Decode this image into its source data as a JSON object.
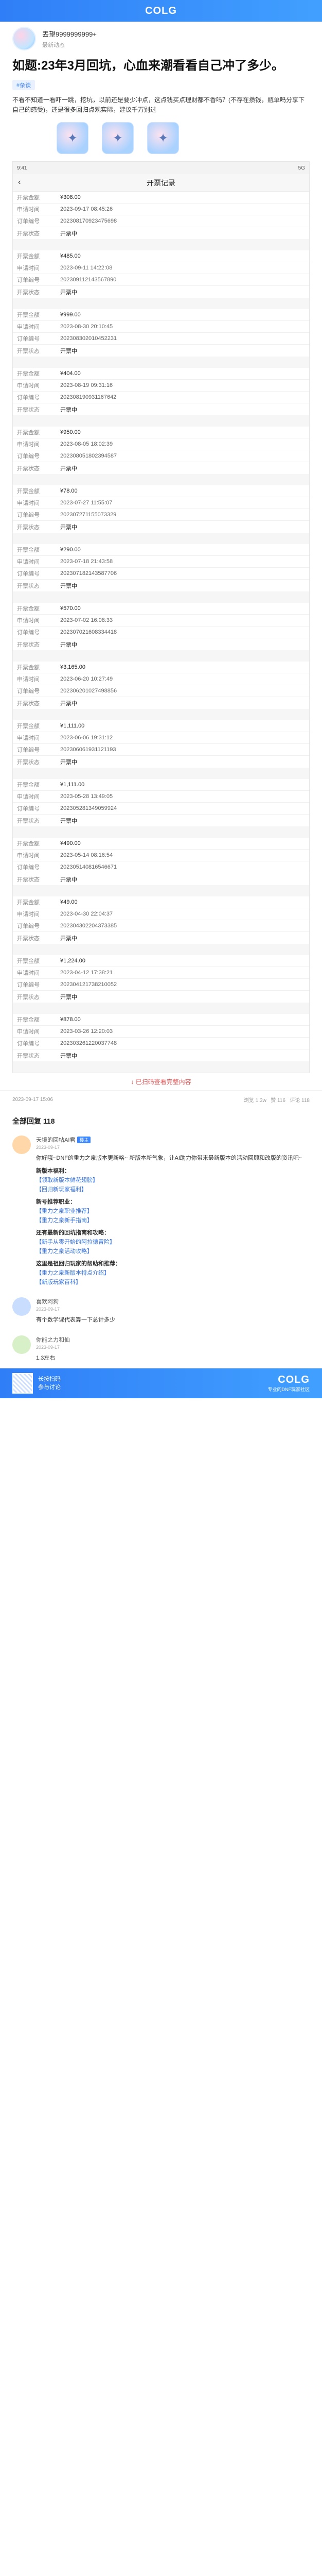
{
  "app": {
    "logo": "COLG"
  },
  "author": {
    "name": "丟望9999999999+",
    "subtitle": "最新动态"
  },
  "post": {
    "title": "如题:23年3月回坑，心血来潮看看自己冲了多少。",
    "tag": "#杂谈",
    "intro": "不看不知道一看吓一跳，挖坑，以前还是要少冲点，这点钱买点理财都不香吗？(不存在攒钱，瓶单吗分享下自己的感受)，还是很多回归点观实际，建议千万别过"
  },
  "screenshot": {
    "status_left": "9:41",
    "status_right": "5G",
    "nav_title": "开票记录",
    "back_icon": "‹",
    "labels": {
      "amount": "开票金额",
      "time": "申请时间",
      "order": "订单编号",
      "status": "开票状态"
    },
    "records": [
      {
        "amount": "¥308.00",
        "time": "2023-09-17 08:45:26",
        "order": "202308170923475698",
        "status": "开票中"
      },
      {
        "amount": "¥485.00",
        "time": "2023-09-11 14:22:08",
        "order": "202309112143567890",
        "status": "开票中"
      },
      {
        "amount": "¥999.00",
        "time": "2023-08-30 20:10:45",
        "order": "202308302010452231",
        "status": "开票中"
      },
      {
        "amount": "¥404.00",
        "time": "2023-08-19 09:31:16",
        "order": "202308190931167642",
        "status": "开票中"
      },
      {
        "amount": "¥950.00",
        "time": "2023-08-05 18:02:39",
        "order": "202308051802394587",
        "status": "开票中"
      },
      {
        "amount": "¥78.00",
        "time": "2023-07-27 11:55:07",
        "order": "202307271155073329",
        "status": "开票中"
      },
      {
        "amount": "¥290.00",
        "time": "2023-07-18 21:43:58",
        "order": "202307182143587706",
        "status": "开票中"
      },
      {
        "amount": "¥570.00",
        "time": "2023-07-02 16:08:33",
        "order": "202307021608334418",
        "status": "开票中"
      },
      {
        "amount": "¥3,165.00",
        "time": "2023-06-20 10:27:49",
        "order": "202306201027498856",
        "status": "开票中"
      },
      {
        "amount": "¥1,111.00",
        "time": "2023-06-06 19:31:12",
        "order": "202306061931121193",
        "status": "开票中"
      },
      {
        "amount": "¥1,111.00",
        "time": "2023-05-28 13:49:05",
        "order": "202305281349059924",
        "status": "开票中"
      },
      {
        "amount": "¥490.00",
        "time": "2023-05-14 08:16:54",
        "order": "202305140816546671",
        "status": "开票中"
      },
      {
        "amount": "¥49.00",
        "time": "2023-04-30 22:04:37",
        "order": "202304302204373385",
        "status": "开票中"
      },
      {
        "amount": "¥1,224.00",
        "time": "2023-04-12 17:38:21",
        "order": "202304121738210052",
        "status": "开票中"
      },
      {
        "amount": "¥878.00",
        "time": "2023-03-26 12:20:03",
        "order": "202303261220037748",
        "status": "开票中"
      }
    ]
  },
  "expand_link": "↓ 已扫码查看完整内容",
  "footer": {
    "date": "2023-09-17 15:06",
    "views": "浏览 1.3w",
    "likes": "赞 116",
    "comments": "评论 118"
  },
  "comments": {
    "header": "全部回复 118",
    "items": [
      {
        "name": "天境的回帖AI君",
        "badge": "楼主",
        "time": "2023-09-17",
        "text": "你好哦~DNF的重力之泉版本更新咯~ 新版本新气象，让AI助力你带来最新版本的活动回顾和改版的资讯吧~",
        "sections": [
          {
            "title": "新版本福利：",
            "links": [
              "【领取新版本鲜花翅膀】",
              "【回归新玩家福利】"
            ]
          },
          {
            "title": "新号推荐职业：",
            "links": [
              "【重力之泉职业推荐】",
              "【重力之泉新手指南】"
            ]
          },
          {
            "title": "还有最新的回坑指南和攻略：",
            "links": [
              "【新手从零开始的阿拉德冒险】",
              "【重力之泉活动攻略】"
            ]
          },
          {
            "title": "这里是祖回归玩家的帮助和推荐：",
            "links": [
              "【重力之泉新版本特点介绍】",
              "【新版玩家百科】"
            ]
          }
        ]
      },
      {
        "name": "喜欢阿狗",
        "badge": "",
        "time": "2023-09-17",
        "text": "有个数学课代表算一下总计多少"
      },
      {
        "name": "你能之力和仙",
        "badge": "",
        "time": "2023-09-17",
        "text": "1.3左右"
      }
    ]
  },
  "bottom_banner": {
    "line1": "长按扫码",
    "line2": "参与讨论",
    "logo": "COLG",
    "sub": "专业的DNF玩家社区"
  },
  "colors": {
    "brand": "#2f7ef7",
    "accent_link": "#2f6fe0",
    "expand_red": "#e05555"
  }
}
